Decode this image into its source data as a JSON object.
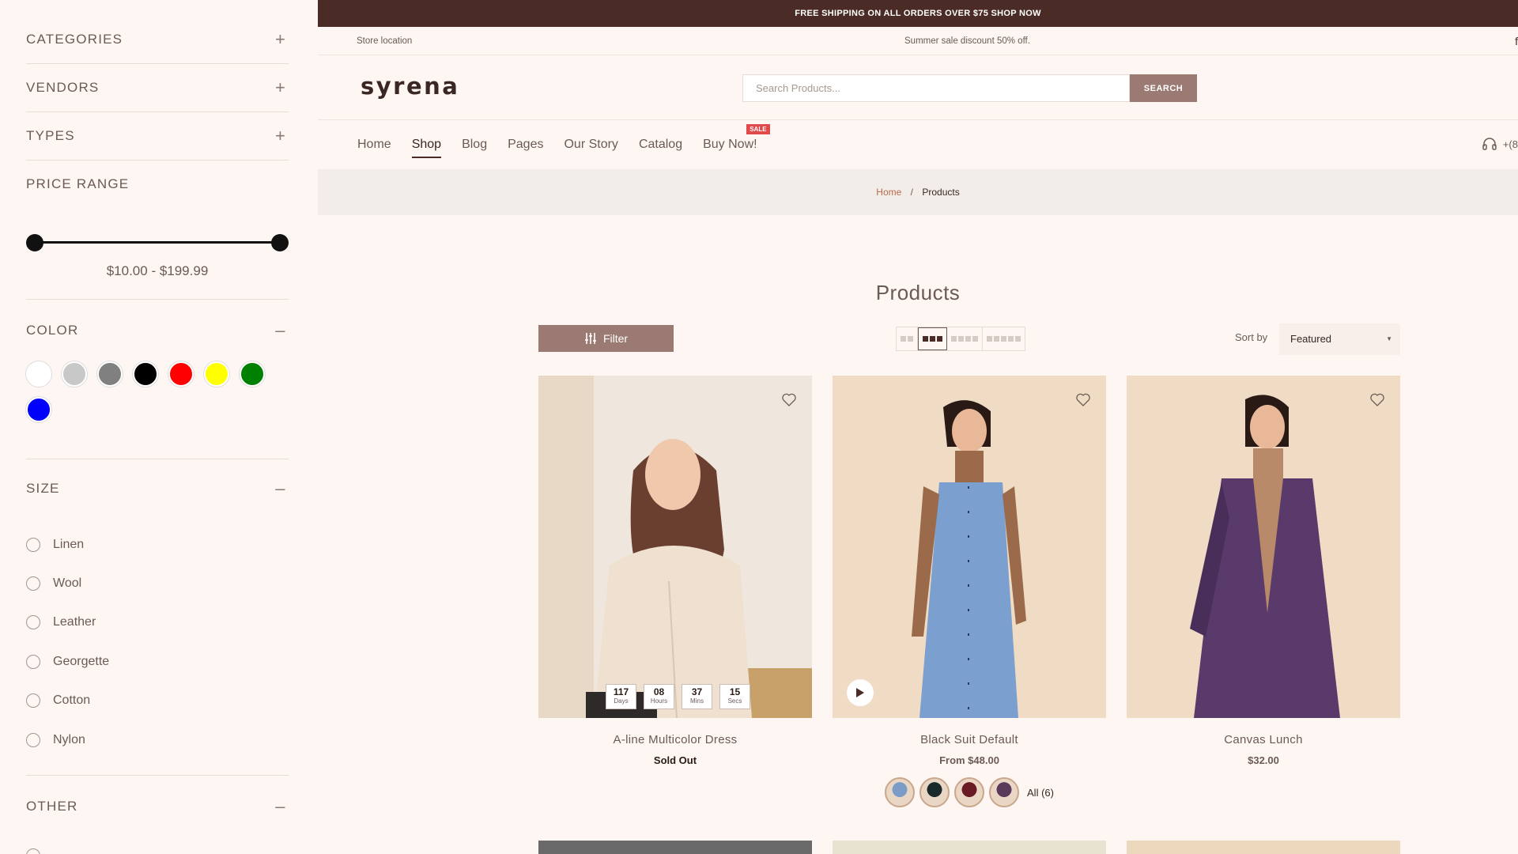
{
  "sidebar": {
    "sections": [
      {
        "label": "CATEGORIES",
        "toggle": "+"
      },
      {
        "label": "VENDORS",
        "toggle": "+"
      },
      {
        "label": "TYPES",
        "toggle": "+"
      }
    ],
    "price": {
      "label": "PRICE RANGE",
      "range": "$10.00 - $199.99",
      "min_fraction": 0.0,
      "max_fraction": 1.0
    },
    "color": {
      "label": "COLOR",
      "toggle": "–",
      "swatches": [
        "#ffffff",
        "#c8c8c8",
        "#808080",
        "#000000",
        "#ff0000",
        "#ffff00",
        "#008000",
        "#0000ff"
      ]
    },
    "size": {
      "label": "SIZE",
      "toggle": "–",
      "items": [
        "Linen",
        "Wool",
        "Leather",
        "Georgette",
        "Cotton",
        "Nylon"
      ]
    },
    "other": {
      "label": "OTHER",
      "toggle": "–"
    }
  },
  "announcement": "FREE SHIPPING ON ALL ORDERS OVER $75 SHOP NOW",
  "infobar": {
    "location": "Store location",
    "promo": "Summer sale discount 50% off.",
    "social_icon": "facebook-icon"
  },
  "header": {
    "logo": "syrena",
    "search_placeholder": "Search Products...",
    "search_button": "SEARCH"
  },
  "nav": {
    "items": [
      "Home",
      "Shop",
      "Blog",
      "Pages",
      "Our Story",
      "Catalog",
      "Buy Now!"
    ],
    "active": "Shop",
    "sale_badge": "SALE",
    "phone": "+(8"
  },
  "breadcrumb": {
    "home": "Home",
    "separator": "/",
    "current": "Products"
  },
  "page_title": "Products",
  "toolbar": {
    "filter_label": "Filter",
    "sort_label": "Sort by",
    "sort_value": "Featured"
  },
  "products": [
    {
      "title": "A-line Multicolor Dress",
      "price": "Sold Out",
      "countdown": [
        {
          "num": "117",
          "label": "Days"
        },
        {
          "num": "08",
          "label": "Hours"
        },
        {
          "num": "37",
          "label": "Mins"
        },
        {
          "num": "15",
          "label": "Secs"
        }
      ]
    },
    {
      "title": "Black Suit Default",
      "price": "From $48.00",
      "variants_label": "All (6)",
      "variant_colors": [
        "#7a9cc6",
        "#1a2a2a",
        "#6a1a25",
        "#5a3a5a"
      ]
    },
    {
      "title": "Canvas Lunch",
      "price": "$32.00"
    }
  ],
  "colors": {
    "brand_dark": "#4a2b26",
    "button": "#9a7a72",
    "background": "#fdf6f3",
    "sale": "#e04a4a"
  }
}
